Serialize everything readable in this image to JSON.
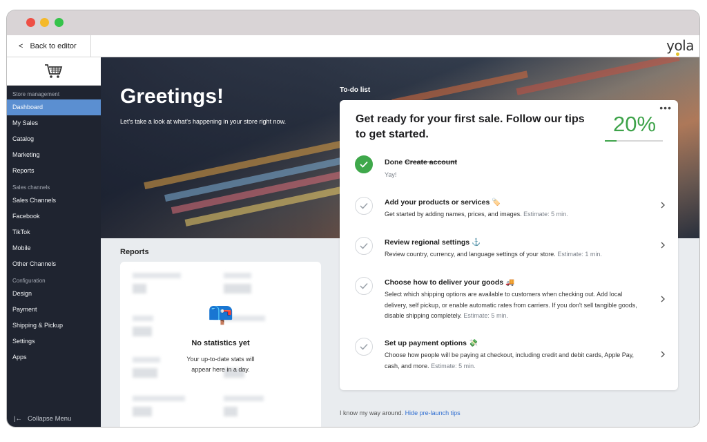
{
  "topbar": {
    "back_label": "Back to editor",
    "logo_text": "yola"
  },
  "sidebar": {
    "sections": [
      {
        "title": "Store management",
        "items": [
          "Dashboard",
          "My Sales",
          "Catalog",
          "Marketing",
          "Reports"
        ]
      },
      {
        "title": "Sales channels",
        "items": [
          "Sales Channels",
          "Facebook",
          "TikTok",
          "Mobile",
          "Other Channels"
        ]
      },
      {
        "title": "Configuration",
        "items": [
          "Design",
          "Payment",
          "Shipping & Pickup",
          "Settings",
          "Apps"
        ]
      }
    ],
    "active_item": "Dashboard",
    "collapse_label": "Collapse Menu"
  },
  "hero": {
    "title": "Greetings!",
    "subtitle": "Let's take a look at what's happening in your store right now."
  },
  "reports": {
    "title": "Reports",
    "empty_icon": "mailbox-icon",
    "empty_title": "No statistics yet",
    "empty_text": "Your up-to-date stats will appear here in a day."
  },
  "todo": {
    "label": "To-do list",
    "heading": "Get ready for your first sale. Follow our tips to get started.",
    "progress_text": "20%",
    "progress_value": 0.2,
    "tasks": [
      {
        "prefix": "Done",
        "title": "Create account",
        "desc": "Yay!",
        "estimate": "",
        "emoji": "",
        "done": true
      },
      {
        "title": "Add your products or services",
        "emoji": "🏷️",
        "desc": "Get started by adding names, prices, and images.",
        "estimate": "Estimate: 5 min.",
        "done": false
      },
      {
        "title": "Review regional settings",
        "emoji": "⚓",
        "desc": "Review country, currency, and language settings of your store.",
        "estimate": "Estimate: 1 min.",
        "done": false
      },
      {
        "title": "Choose how to deliver your goods",
        "emoji": "🚚",
        "desc": "Select which shipping options are available to customers when checking out. Add local delivery, self pickup, or enable automatic rates from carriers. If you don't sell tangible goods, disable shipping completely.",
        "estimate": "Estimate: 5 min.",
        "done": false
      },
      {
        "title": "Set up payment options",
        "emoji": "💸",
        "desc": "Choose how people will be paying at checkout, including credit and debit cards, Apple Pay, cash, and more.",
        "estimate": "Estimate: 5 min.",
        "done": false
      }
    ],
    "footer_text": "I know my way around.",
    "footer_link": "Hide pre-launch tips"
  },
  "colors": {
    "accent": "#5b8fd1",
    "success": "#3ea34a",
    "sidebar_bg": "#1f2430",
    "link": "#2f6ed1"
  }
}
